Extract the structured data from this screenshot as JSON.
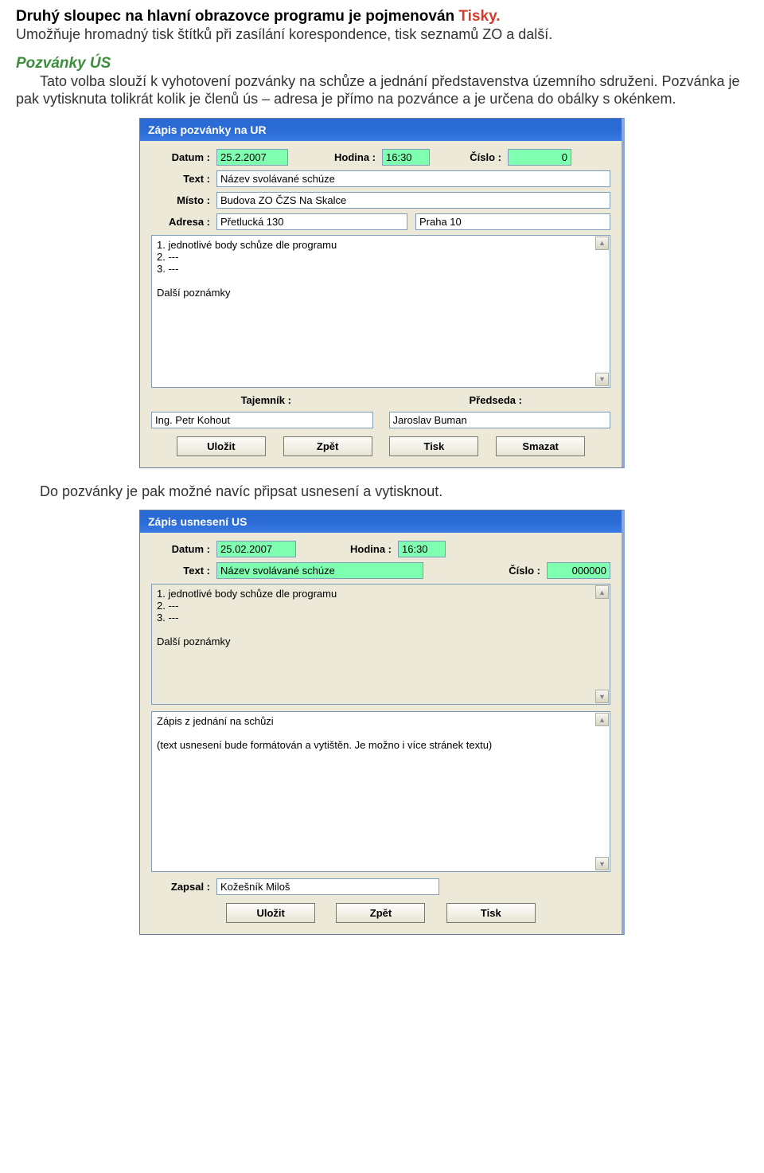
{
  "doc": {
    "heading_pre": "Druhý sloupec na hlavní obrazovce programu je pojmenován ",
    "heading_hi": "Tisky.",
    "heading_post": "Umožňuje hromadný tisk štítků při zasílání korespondence, tisk seznamů ZO a další.",
    "sub1": "Pozvánky ÚS",
    "para1a": "Tato volba slouží k vyhotovení pozvánky na schůze a jednání představenstva územního sdruženi. Pozvánka je pak vytisknuta tolikrát kolik je členů ús – adresa je přímo na pozvánce a je určena do obálky s okénkem.",
    "para2": "Do pozvánky je pak možné navíc připsat usnesení a vytisknout."
  },
  "dlg1": {
    "title": "Zápis pozvánky na UR",
    "labels": {
      "datum": "Datum :",
      "hodina": "Hodina :",
      "cislo": "Číslo :",
      "text": "Text :",
      "misto": "Místo :",
      "adresa": "Adresa :",
      "tajemnik": "Tajemník :",
      "predseda": "Předseda :"
    },
    "values": {
      "datum": "25.2.2007",
      "hodina": "16:30",
      "cislo": "0",
      "text": "Název svolávané schúze",
      "misto": "Budova ZO ČZS Na Skalce",
      "adresa1": "Přetlucká 130",
      "adresa2": "Praha 10",
      "body": "1. jednotlivé body schůze dle programu\n2. ---\n3. ---\n\nDalší poznámky",
      "tajemnik": "Ing. Petr Kohout",
      "predseda": "Jaroslav Buman"
    },
    "buttons": {
      "ulozit": "Uložit",
      "zpet": "Zpět",
      "tisk": "Tisk",
      "smazat": "Smazat"
    }
  },
  "dlg2": {
    "title": "Zápis usnesení US",
    "labels": {
      "datum": "Datum :",
      "hodina": "Hodina :",
      "text": "Text :",
      "cislo": "Číslo :",
      "zapsal": "Zapsal :"
    },
    "values": {
      "datum": "25.02.2007",
      "hodina": "16:30",
      "text": "Název svolávané schúze",
      "cislo": "000000",
      "body1": "1. jednotlivé body schůze dle programu\n2. ---\n3. ---\n\nDalší poznámky",
      "body2": "Zápis z jednání na schůzi\n\n(text usnesení bude formátován a vytištěn. Je možno i více stránek textu)",
      "zapsal": "Kožešník Miloš"
    },
    "buttons": {
      "ulozit": "Uložit",
      "zpet": "Zpět",
      "tisk": "Tisk"
    }
  }
}
